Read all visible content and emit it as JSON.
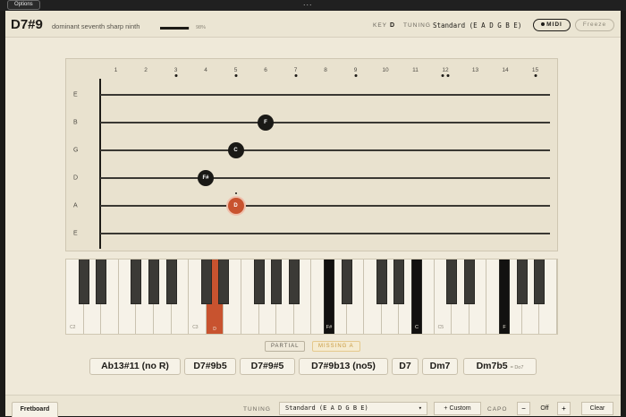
{
  "titlebar": {
    "options_label": "Options",
    "menu_dots": "..."
  },
  "header": {
    "chord_name": "D7#9",
    "chord_desc": "dominant seventh sharp ninth",
    "confidence_text": "98%",
    "confidence_value": 0.98,
    "key_label": "KEY",
    "key_value": "D",
    "tuning_label": "TUNING",
    "tuning_value": "Standard (E A D G B E)",
    "midi_label": "MIDI",
    "freeze_label": "Freeze"
  },
  "fretboard": {
    "fret_numbers": [
      "1",
      "2",
      "3",
      "4",
      "5",
      "6",
      "7",
      "8",
      "9",
      "10",
      "11",
      "12",
      "13",
      "14",
      "15"
    ],
    "inlay_frets": [
      3,
      5,
      7,
      9,
      12,
      15
    ],
    "double_inlay_frets": [
      12
    ],
    "strings": [
      "E",
      "B",
      "G",
      "D",
      "A",
      "E"
    ],
    "notes": [
      {
        "label": "F",
        "string": 1,
        "fret": 6,
        "root": false
      },
      {
        "label": "C",
        "string": 2,
        "fret": 5,
        "root": false
      },
      {
        "label": "F#",
        "string": 3,
        "fret": 4,
        "root": false
      },
      {
        "label": "D",
        "string": 4,
        "fret": 5,
        "root": true
      }
    ]
  },
  "keyboard": {
    "octave_labels": [
      "C2",
      "C3",
      "C5"
    ],
    "highlighted": [
      {
        "note": "D",
        "type": "white",
        "index": 8,
        "root": true
      },
      {
        "note": "F#",
        "type": "black",
        "index": 10,
        "root": false
      },
      {
        "note": "C",
        "type": "black",
        "index": 14,
        "root": false
      },
      {
        "note": "F",
        "type": "black",
        "index": 17,
        "root": false
      }
    ]
  },
  "status": {
    "partial_label": "PARTIAL",
    "missing_label": "MISSING A"
  },
  "alternatives": [
    {
      "name": "Ab13#11 (no R)"
    },
    {
      "name": "D7#9b5"
    },
    {
      "name": "D7#9#5"
    },
    {
      "name": "D7#9b13 (no5)"
    },
    {
      "name": "D7"
    },
    {
      "name": "Dm7"
    },
    {
      "name": "Dm7b5",
      "equiv": "= Do7"
    }
  ],
  "footer": {
    "tab_label": "Fretboard",
    "tuning_label": "TUNING",
    "tuning_select": "Standard (E A D G B E)",
    "custom_label": "+ Custom",
    "capo_label": "CAPO",
    "capo_minus": "−",
    "capo_value": "Off",
    "capo_plus": "+",
    "clear_label": "Clear"
  },
  "colors": {
    "accent": "#c8532f",
    "background": "#efe9d9",
    "ink": "#1d1b17"
  }
}
